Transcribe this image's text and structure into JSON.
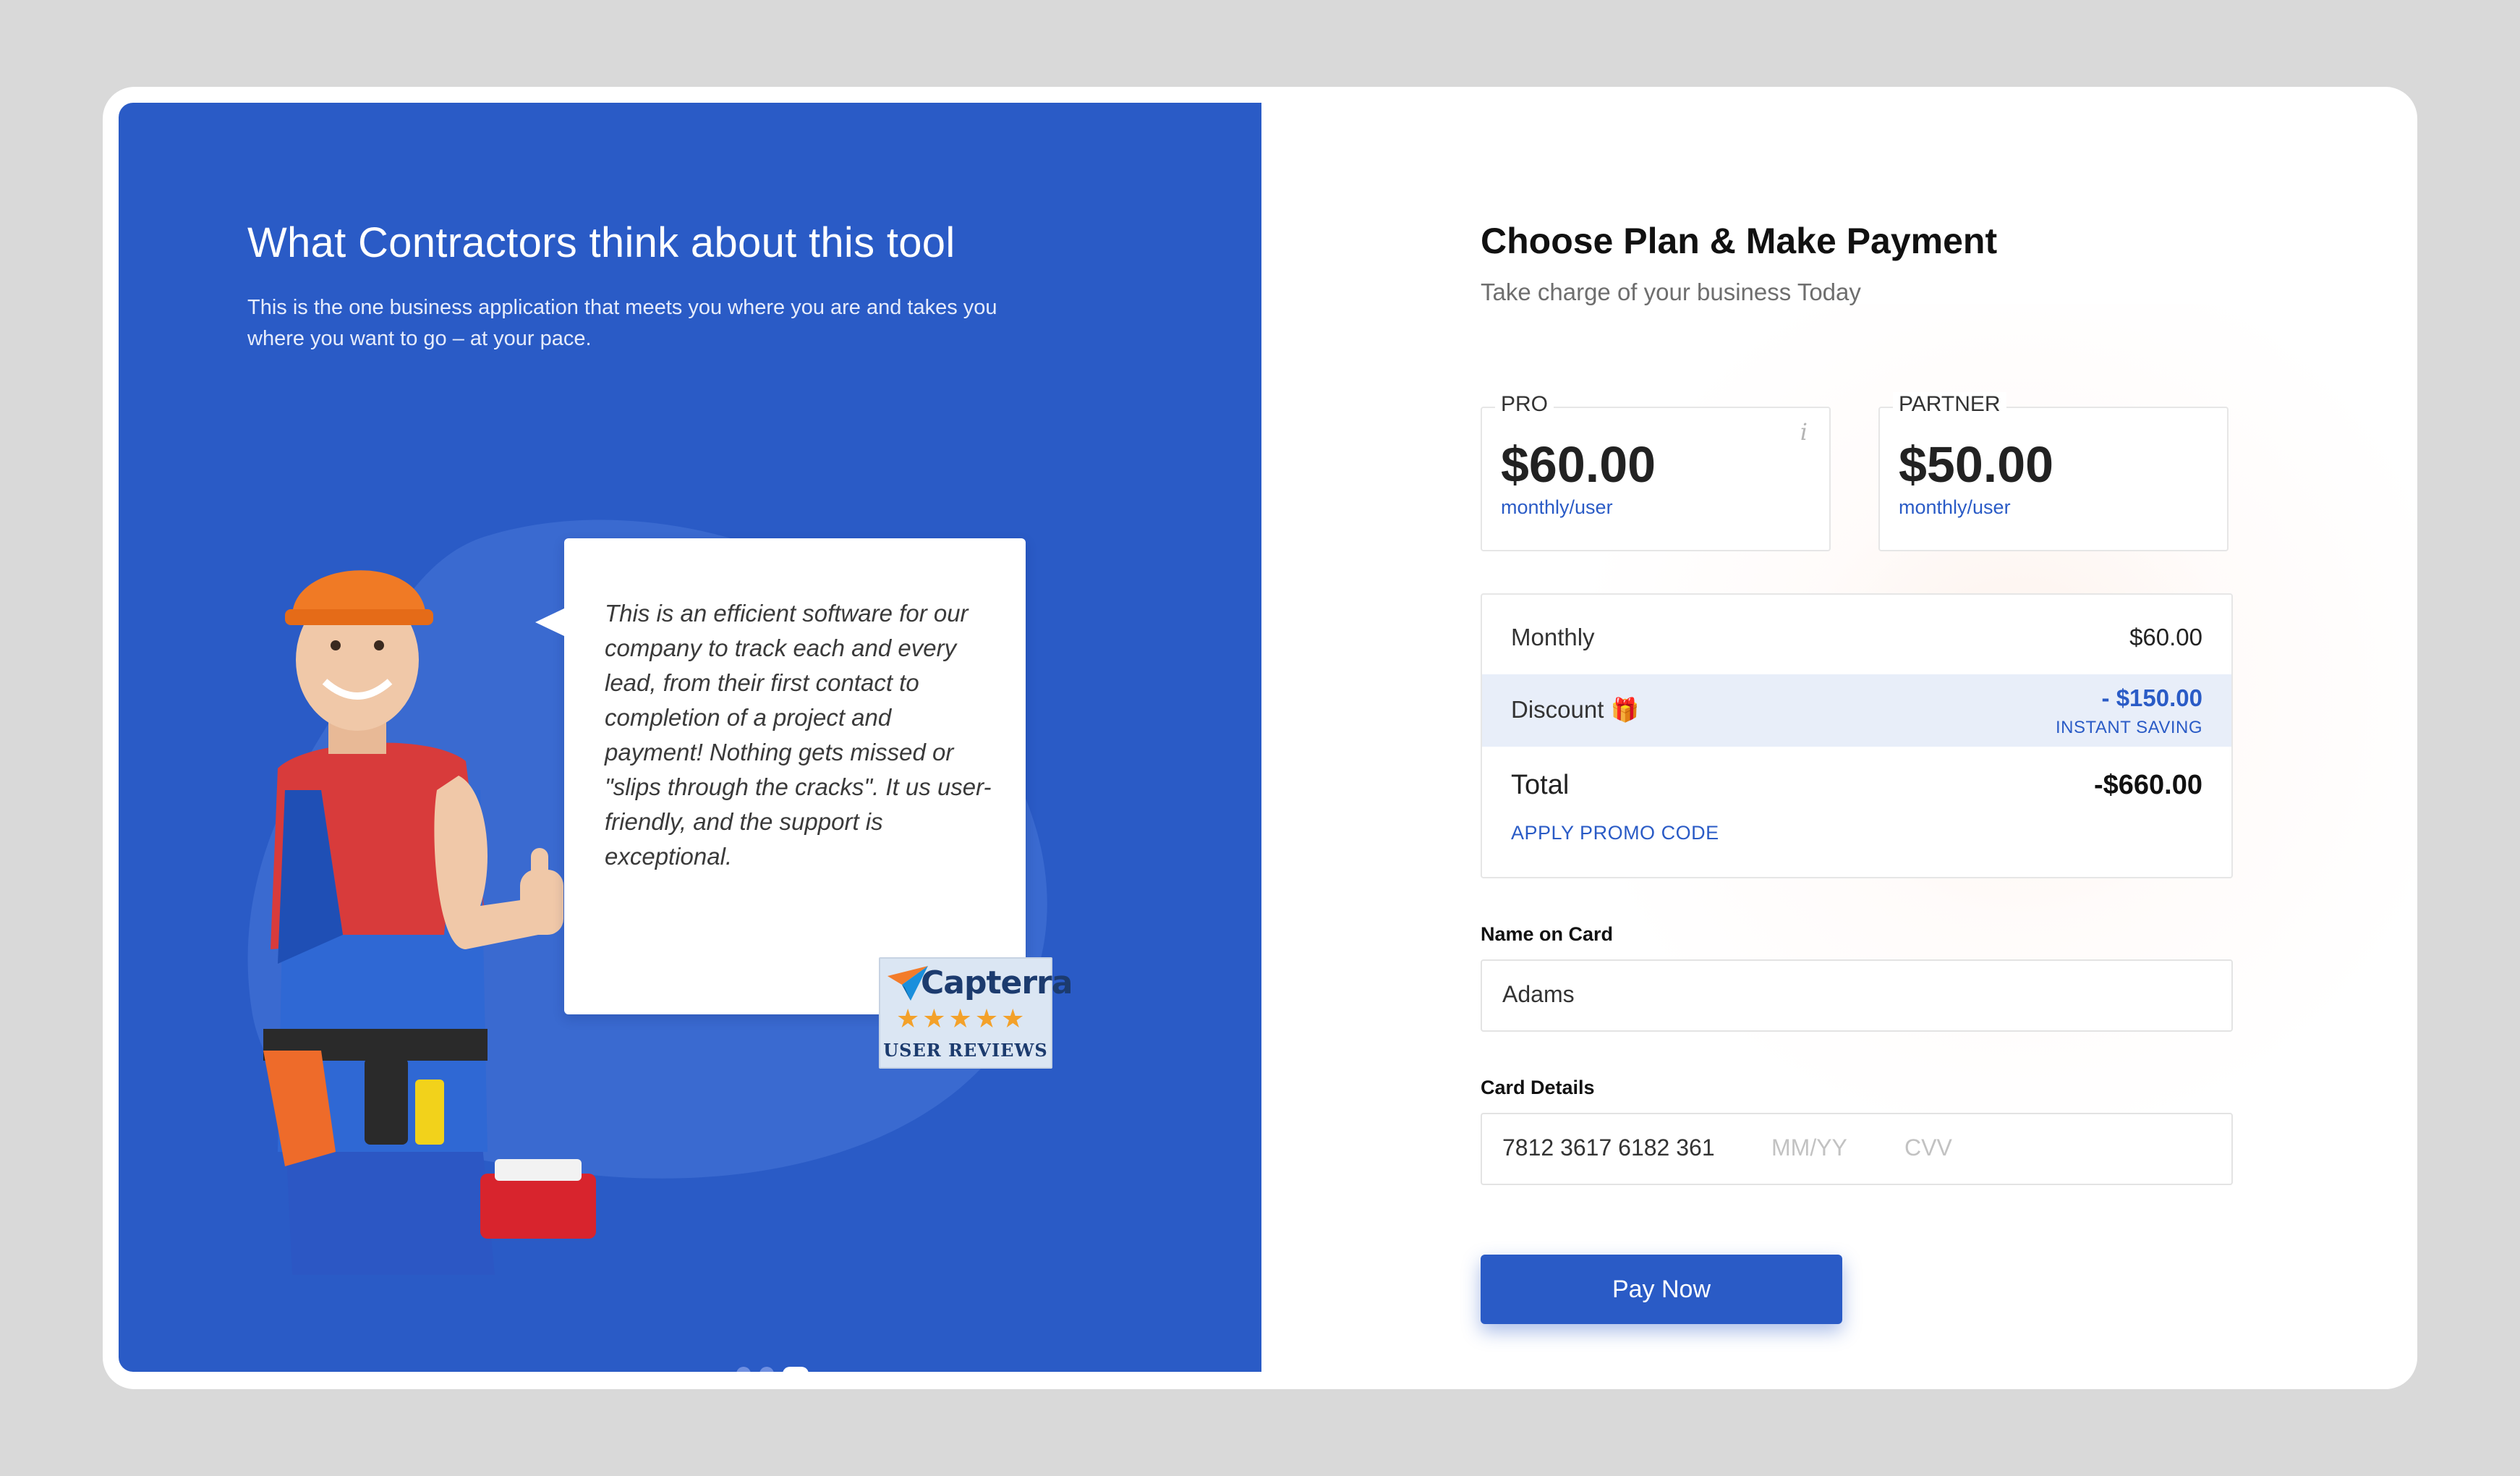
{
  "testimonial_panel": {
    "title": "What Contractors think about this tool",
    "subtitle": "This is the one business application that meets you where you are and takes you where you want to go – at your pace.",
    "quote": "This is an efficient software for our company to track each and every lead, from their first contact to completion of a project and payment! Nothing gets missed or \"slips through the cracks\". It us user-friendly, and the support is exceptional.",
    "badge": {
      "brand": "Capterra",
      "stars": "★★★★★",
      "label": "USER REVIEWS",
      "rating": 4.5
    },
    "carousel": {
      "slides": 3,
      "active": 3
    },
    "colors": {
      "panel_bg": "#2a5bc6",
      "accent": "#f3a12a"
    }
  },
  "payment": {
    "title": "Choose Plan & Make Payment",
    "subtitle": "Take charge of your business Today",
    "plans": [
      {
        "label": "PRO",
        "price": "$60.00",
        "unit": "monthly/user",
        "info_icon": "info-icon"
      },
      {
        "label": "PARTNER",
        "price": "$50.00",
        "unit": "monthly/user"
      }
    ],
    "summary": {
      "monthly_label": "Monthly",
      "monthly_value": "$60.00",
      "discount_label": "Discount",
      "discount_icon": "gift-icon",
      "discount_value": "- $150.00",
      "discount_note": "INSTANT SAVING",
      "total_label": "Total",
      "total_value": "-$660.00",
      "promo_link": "APPLY PROMO CODE"
    },
    "name_field": {
      "label": "Name on Card",
      "value": "Adams"
    },
    "card_field": {
      "label": "Card Details",
      "number": "7812 3617 6182 361",
      "expiry_placeholder": "MM/YY",
      "cvv_placeholder": "CVV"
    },
    "pay_button": "Pay Now",
    "colors": {
      "primary": "#2a5bc6"
    }
  }
}
